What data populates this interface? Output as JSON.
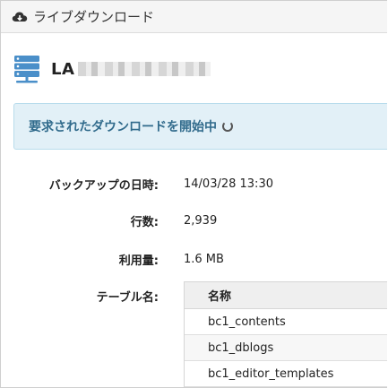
{
  "header": {
    "title": "ライブダウンロード",
    "icon": "cloud-download-icon"
  },
  "database": {
    "icon": "database-server-icon",
    "name_visible": "LA",
    "accent_color": "#4a8fc9"
  },
  "alert": {
    "message": "要求されたダウンロードを開始中",
    "spinner_icon": "loading-spinner-icon",
    "background": "#e2f0f7",
    "text_color": "#316b8c"
  },
  "fields": {
    "backup_label": "バックアップの日時:",
    "backup_value": "14/03/28 13:30",
    "rows_label": "行数:",
    "rows_value": "2,939",
    "usage_label": "利用量:",
    "usage_value": "1.6 MB",
    "tables_label": "テーブル名:"
  },
  "tables": {
    "column_header": "名称",
    "rows": [
      "bc1_contents",
      "bc1_dblogs",
      "bc1_editor_templates"
    ]
  }
}
